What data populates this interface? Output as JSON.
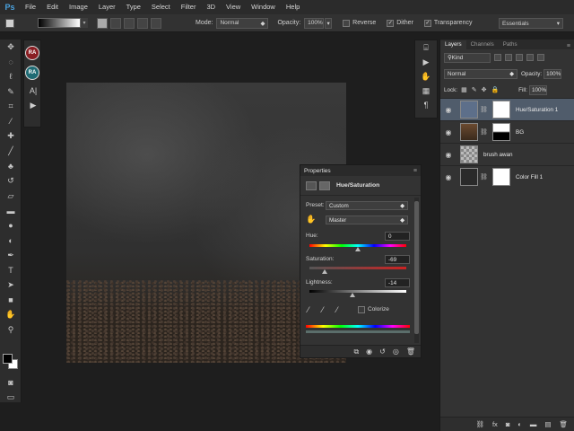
{
  "app": {
    "logo": "Ps"
  },
  "menu": [
    "File",
    "Edit",
    "Image",
    "Layer",
    "Type",
    "Select",
    "Filter",
    "3D",
    "View",
    "Window",
    "Help"
  ],
  "options": {
    "mode_label": "Mode:",
    "mode_value": "Normal",
    "opacity_label": "Opacity:",
    "opacity_value": "100%",
    "reverse_label": "Reverse",
    "dither_label": "Dither",
    "transparency_label": "Transparency",
    "workspace": "Essentials"
  },
  "ministrip": {
    "ra1": "RA",
    "ra2": "RA",
    "char_icon": "A|"
  },
  "properties": {
    "tab": "Properties",
    "title": "Hue/Saturation",
    "preset_label": "Preset:",
    "preset_value": "Custom",
    "channel_value": "Master",
    "hue_label": "Hue:",
    "hue_value": "0",
    "saturation_label": "Saturation:",
    "saturation_value": "-69",
    "lightness_label": "Lightness:",
    "lightness_value": "-14",
    "colorize_label": "Colorize"
  },
  "layers_panel": {
    "tabs": [
      "Layers",
      "Channels",
      "Paths"
    ],
    "filter_label": "Kind",
    "blend_mode": "Normal",
    "opacity_label": "Opacity:",
    "opacity_value": "100%",
    "lock_label": "Lock:",
    "fill_label": "Fill:",
    "fill_value": "100%",
    "layers": [
      {
        "name": "Hue/Saturation 1",
        "selected": true
      },
      {
        "name": "BG",
        "selected": false
      },
      {
        "name": "brush awan",
        "selected": false
      },
      {
        "name": "Color Fill 1",
        "selected": false
      }
    ]
  },
  "colors": {
    "accent": "#4aa3e0",
    "selected_layer": "#505c6b",
    "foreground": "#000000",
    "background": "#ffffff"
  }
}
